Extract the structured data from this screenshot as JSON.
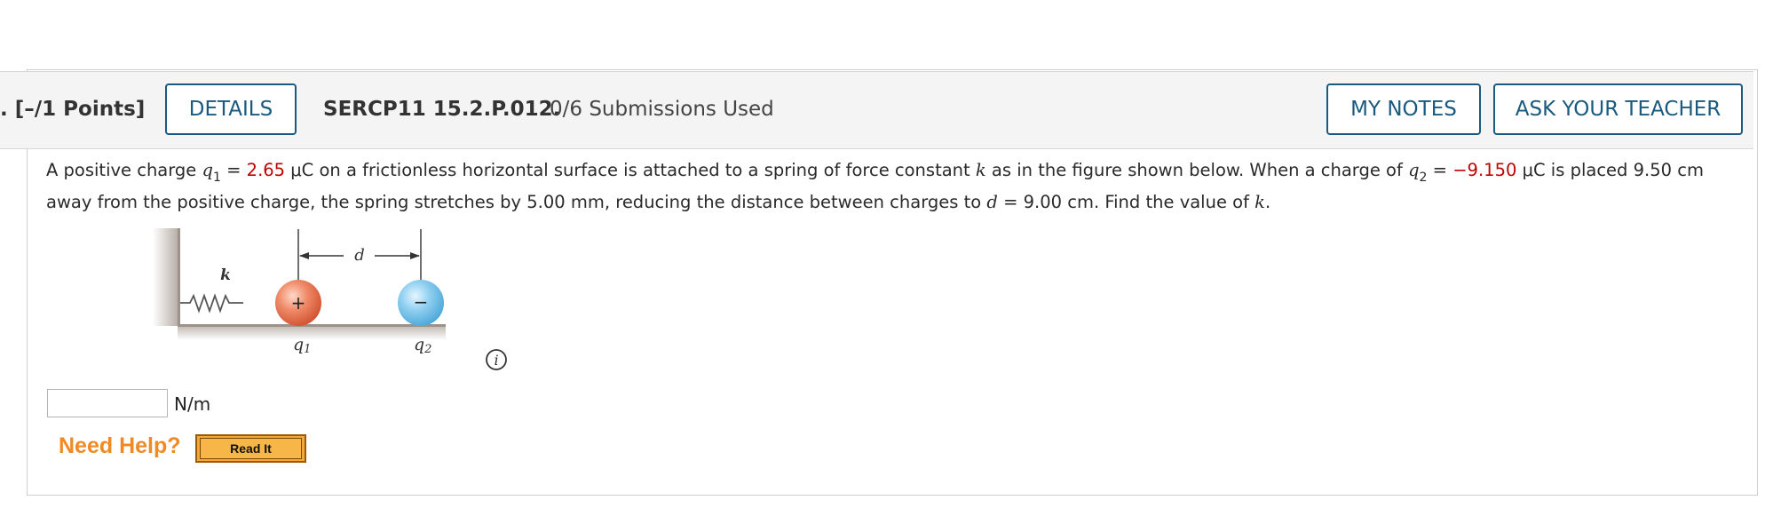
{
  "header": {
    "points": ". [–/1 Points]",
    "details_label": "DETAILS",
    "problem_code": "SERCP11 15.2.P.012.",
    "submissions": "0/6 Submissions Used",
    "my_notes_label": "MY NOTES",
    "ask_teacher_label": "ASK YOUR TEACHER"
  },
  "question": {
    "p1": "A positive charge ",
    "q1_var": "q",
    "q1_sub": "1",
    "eq1": " = ",
    "q1_value": "2.65",
    "p2": " μC on a frictionless horizontal surface is attached to a spring of force constant ",
    "k_var": "k",
    "p3": " as in the figure shown below. When a charge of ",
    "q2_var": "q",
    "q2_sub": "2",
    "eq2": " = ",
    "q2_value": "−9.150",
    "p4": " μC is placed 9.50 cm away from the positive charge, the spring stretches by 5.00 mm, reducing the distance between charges to ",
    "d_var": "d",
    "p5": " = 9.00 cm. Find the value of ",
    "k_var2": "k",
    "p6": "."
  },
  "figure": {
    "spring_label": "k",
    "distance_label": "d",
    "plus_sign": "+",
    "minus_sign": "−",
    "q1_label": "q",
    "q1_label_sub": "1",
    "q2_label": "q",
    "q2_label_sub": "2",
    "info_symbol": "i"
  },
  "answer": {
    "value": "",
    "unit": "N/m"
  },
  "help": {
    "need_help_label": "Need Help?",
    "read_it_label": "Read It"
  },
  "colors": {
    "accent": "#1a5a7e",
    "given_value": "#c00000",
    "need_help": "#f08a24",
    "read_it_bg": "#f3a93a"
  }
}
